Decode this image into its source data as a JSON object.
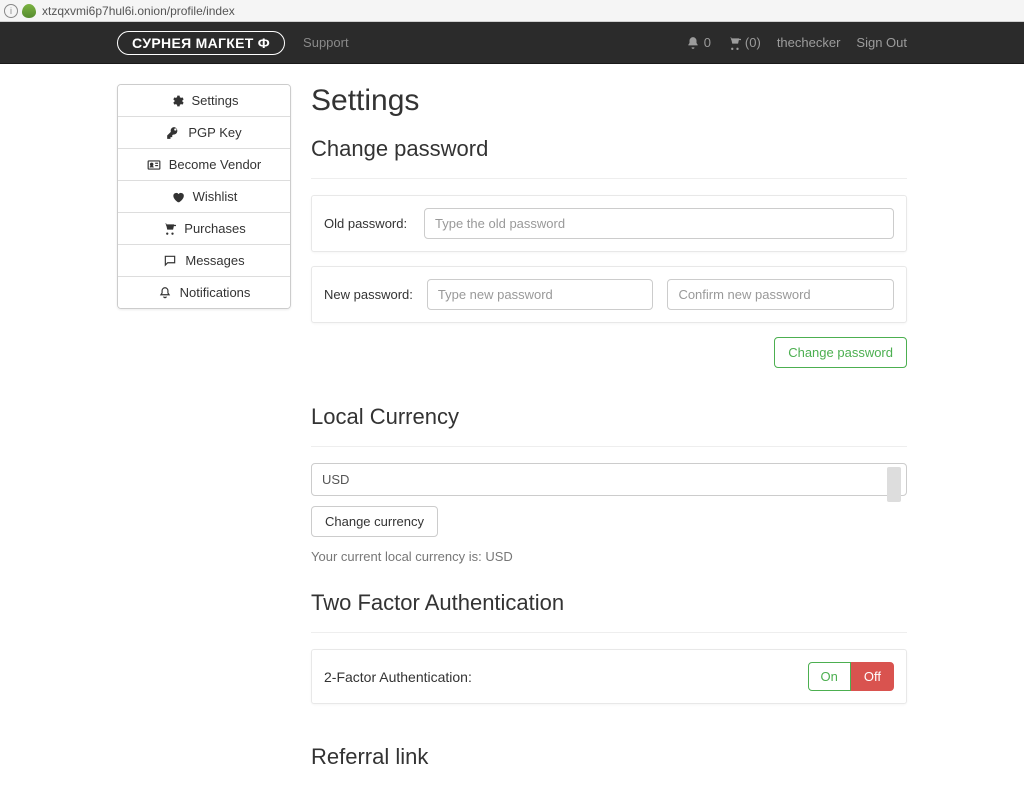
{
  "url": "xtzqxvmi6p7hul6i.onion/profile/index",
  "header": {
    "brand": "CУРНЕЯ МАГКЕТ Ф",
    "support": "Support",
    "notifications_count": "0",
    "cart_count": "(0)",
    "username": "thechecker",
    "sign_out": "Sign Out"
  },
  "sidebar": {
    "items": [
      {
        "label": "Settings"
      },
      {
        "label": "PGP Key"
      },
      {
        "label": "Become Vendor"
      },
      {
        "label": "Wishlist"
      },
      {
        "label": "Purchases"
      },
      {
        "label": "Messages"
      },
      {
        "label": "Notifications"
      }
    ]
  },
  "settings": {
    "title": "Settings",
    "change_password": {
      "heading": "Change password",
      "old_label": "Old password:",
      "old_placeholder": "Type the old password",
      "new_label": "New password:",
      "new_placeholder": "Type new password",
      "confirm_placeholder": "Confirm new password",
      "button": "Change password"
    },
    "currency": {
      "heading": "Local Currency",
      "selected": "USD",
      "button": "Change currency",
      "note": "Your current local currency is: USD"
    },
    "two_factor": {
      "heading": "Two Factor Authentication",
      "label": "2-Factor Authentication:",
      "on": "On",
      "off": "Off"
    },
    "referral": {
      "heading": "Referral link"
    }
  }
}
